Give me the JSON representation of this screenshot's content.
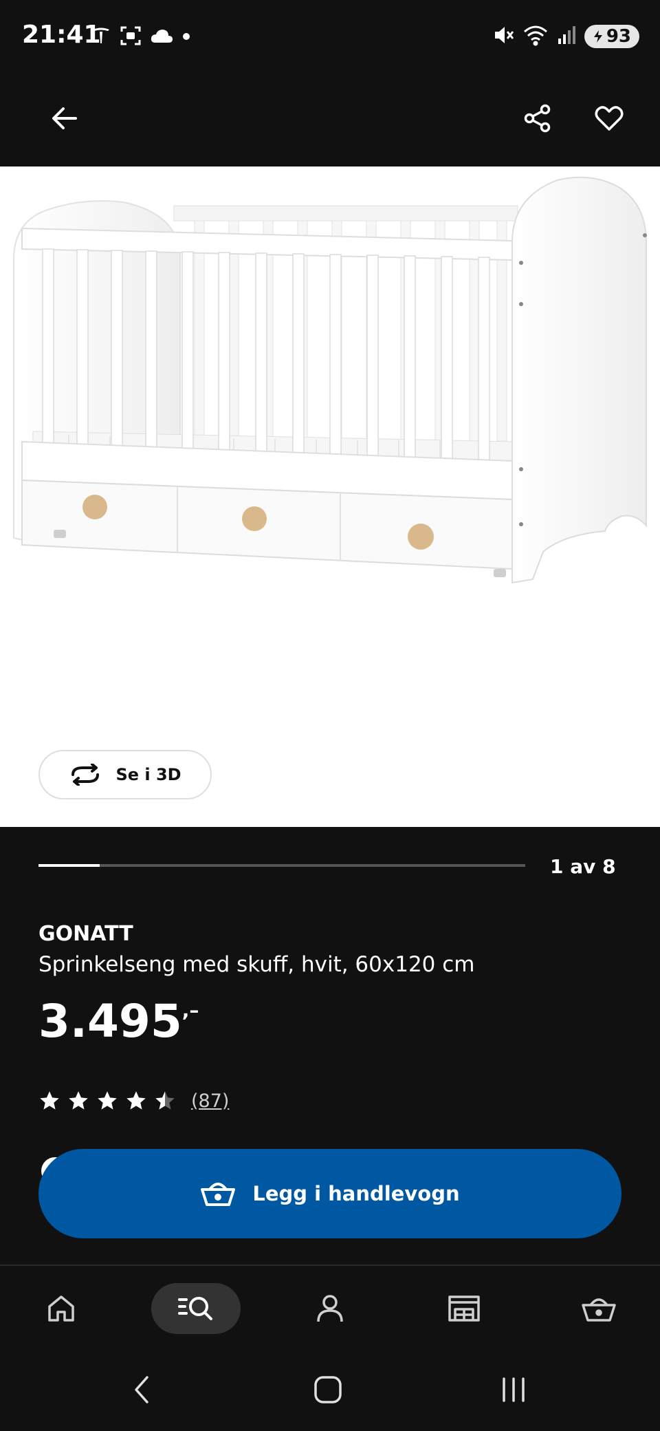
{
  "status_bar": {
    "time": "21:41",
    "battery": "93",
    "left_icons": [
      "tesla-icon",
      "screenshot-icon",
      "cloud-icon",
      "dot-icon"
    ],
    "right_icons": [
      "mute-icon",
      "wifi-icon",
      "signal-icon",
      "battery-icon"
    ]
  },
  "app_bar": {
    "icons": [
      "arrow-left-icon",
      "share-icon",
      "heart-icon"
    ]
  },
  "gallery": {
    "view_3d_label": "Se i 3D",
    "pager_text": "1 av 8",
    "progress_fraction": 0.125
  },
  "product": {
    "name": "GONATT",
    "description": "Sprinkelseng med skuff, hvit, 60x120 cm",
    "price_main": "3.495",
    "price_suffix": ",–",
    "rating_value": 4.5,
    "rating_max": 5,
    "review_count": "(87)"
  },
  "cart": {
    "button_label": "Legg i handlevogn"
  },
  "bottom_nav": {
    "items": [
      {
        "icon": "home-icon",
        "active": false
      },
      {
        "icon": "search-list-icon",
        "active": true
      },
      {
        "icon": "profile-icon",
        "active": false
      },
      {
        "icon": "store-icon",
        "active": false
      },
      {
        "icon": "basket-icon",
        "active": false
      }
    ]
  },
  "system_nav": {
    "icons": [
      "system-back-icon",
      "system-home-icon",
      "system-recents-icon"
    ]
  },
  "colors": {
    "background": "#111111",
    "primary_blue": "#0058a3",
    "white": "#ffffff"
  }
}
